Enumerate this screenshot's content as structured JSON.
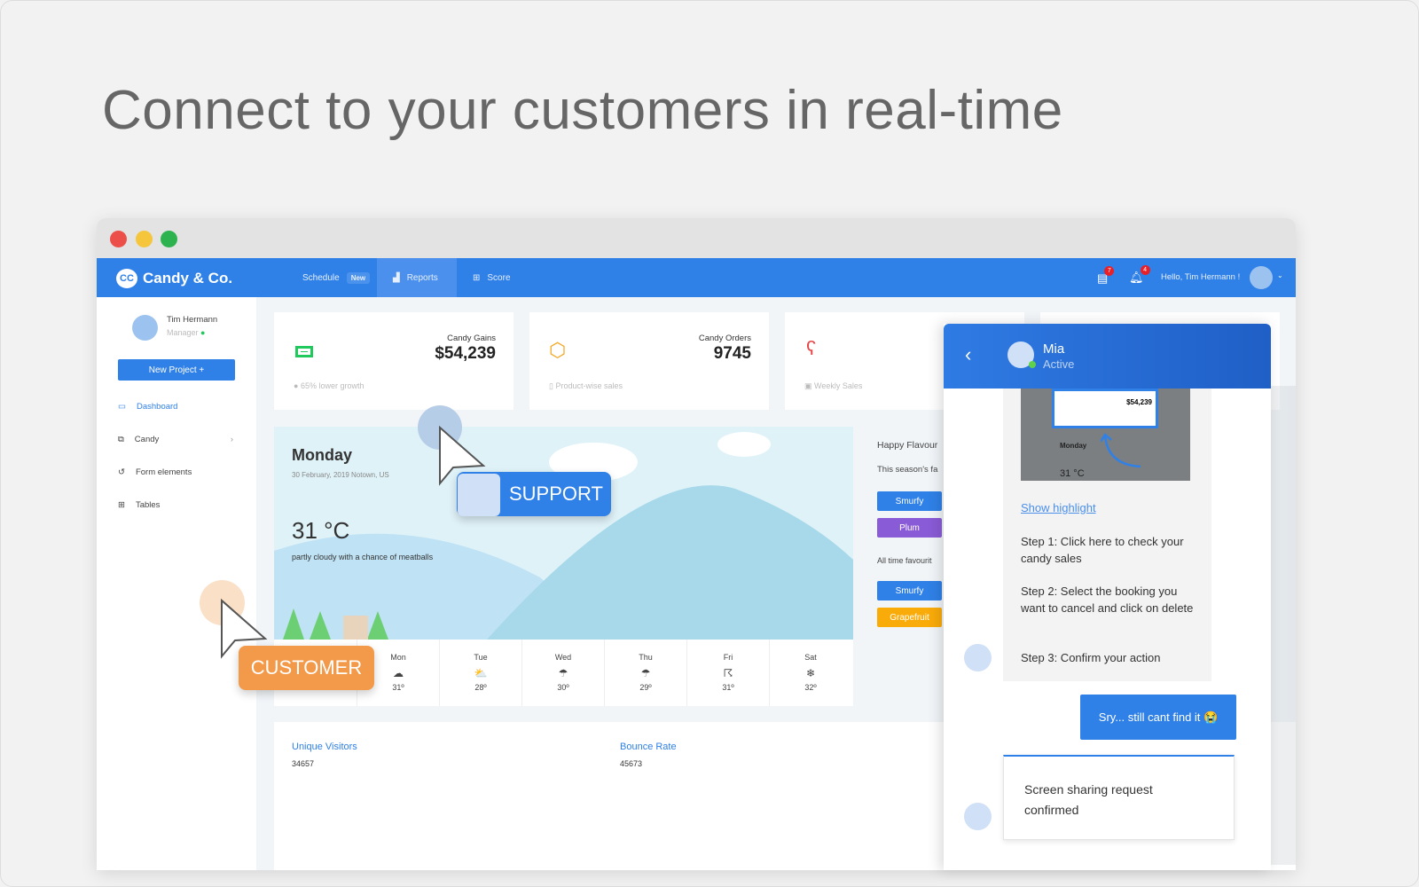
{
  "headline": "Connect to your customers in real-time",
  "colors": {
    "brand": "#2f80e7",
    "support": "#2f80e7",
    "customer": "#f39a4a",
    "smurfy": "#2f80e7",
    "plum": "#8a5bd6",
    "grapefruit": "#f9ab0a"
  },
  "nav": {
    "brand": "Candy & Co.",
    "logo_text": "CC",
    "items": [
      {
        "label": "Schedule",
        "badge": "New"
      },
      {
        "label": "Reports",
        "icon": "chart-icon"
      },
      {
        "label": "Score",
        "icon": "bookmark-icon"
      }
    ],
    "doc_count": "7",
    "bell_count": "4",
    "greeting": "Hello, Tim Hermann !"
  },
  "user": {
    "name": "Tim Hermann",
    "role": "Manager"
  },
  "sidebar": {
    "new_project": "New Project +",
    "items": [
      {
        "label": "Dashboard",
        "icon": "monitor-icon"
      },
      {
        "label": "Candy",
        "icon": "copy-icon"
      },
      {
        "label": "Form elements",
        "icon": "history-icon"
      },
      {
        "label": "Tables",
        "icon": "table-icon"
      }
    ]
  },
  "cards": [
    {
      "label": "Candy Gains",
      "value": "$54,239",
      "footer": "65% lower growth"
    },
    {
      "label": "Candy Orders",
      "value": "9745",
      "footer": "Product-wise sales"
    },
    {
      "label": "",
      "value": "",
      "footer": "Weekly Sales"
    }
  ],
  "weather": {
    "day": "Monday",
    "date": "30 February, 2019 Notown, US",
    "temp": "31 °C",
    "desc": "partly cloudy with a chance of meatballs",
    "forecast": [
      {
        "day": "Mon",
        "temp": "31º"
      },
      {
        "day": "Tue",
        "temp": "28º"
      },
      {
        "day": "Wed",
        "temp": "30º"
      },
      {
        "day": "Thu",
        "temp": "29º"
      },
      {
        "day": "Fri",
        "temp": "31º"
      },
      {
        "day": "Sat",
        "temp": "32º"
      }
    ]
  },
  "flavours": {
    "title": "Happy Flavour",
    "season": "This season's fa",
    "season_items": [
      "Smurfy",
      "Plum"
    ],
    "alltime": "All time favourit",
    "alltime_items": [
      "Smurfy",
      "Grapefruit"
    ]
  },
  "stats": [
    {
      "label": "Unique Visitors",
      "value": "34657"
    },
    {
      "label": "Bounce Rate",
      "value": "45673"
    }
  ],
  "tags": {
    "support": "SUPPORT",
    "customer": "CUSTOMER"
  },
  "chat": {
    "name": "Mia",
    "status": "Active",
    "preview": {
      "label": "Candy Gains",
      "value": "$54,239",
      "day": "Monday",
      "temp": "31 °C"
    },
    "link": "Show highlight",
    "steps": [
      "Step 1: Click here to check your candy sales",
      "Step 2: Select the booking you want to cancel and click on delete",
      "Step 3: Confirm your action"
    ],
    "user_msg": "Sry... still cant find it 😭",
    "confirm": "Screen sharing request confirmed"
  }
}
